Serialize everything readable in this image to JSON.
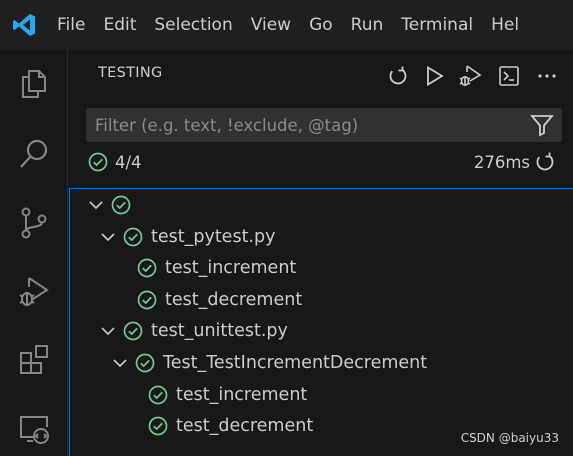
{
  "menu": [
    "File",
    "Edit",
    "Selection",
    "View",
    "Go",
    "Run",
    "Terminal",
    "Hel"
  ],
  "panel": {
    "title": "TESTING"
  },
  "filter": {
    "placeholder": "Filter (e.g. text, !exclude, @tag)"
  },
  "summary": {
    "count": "4/4",
    "duration": "276ms"
  },
  "tree": {
    "root": "",
    "file1": "test_pytest.py",
    "file1_test1": "test_increment",
    "file1_test2": "test_decrement",
    "file2": "test_unittest.py",
    "class1": "Test_TestIncrementDecrement",
    "class1_test1": "test_increment",
    "class1_test2": "test_decrement"
  },
  "watermark": "CSDN @baiyu33",
  "colors": {
    "pass": "#73c991",
    "accent": "#0078d4",
    "logo": "#23a9f2"
  },
  "icons": [
    "vscode-logo-icon",
    "explorer-icon",
    "search-icon",
    "source-control-icon",
    "run-debug-icon",
    "extensions-icon",
    "remote-explorer-icon",
    "refresh-icon",
    "run-all-icon",
    "debug-all-icon",
    "terminal-icon",
    "more-icon",
    "filter-icon",
    "pass-check-icon",
    "chevron-down-icon"
  ]
}
